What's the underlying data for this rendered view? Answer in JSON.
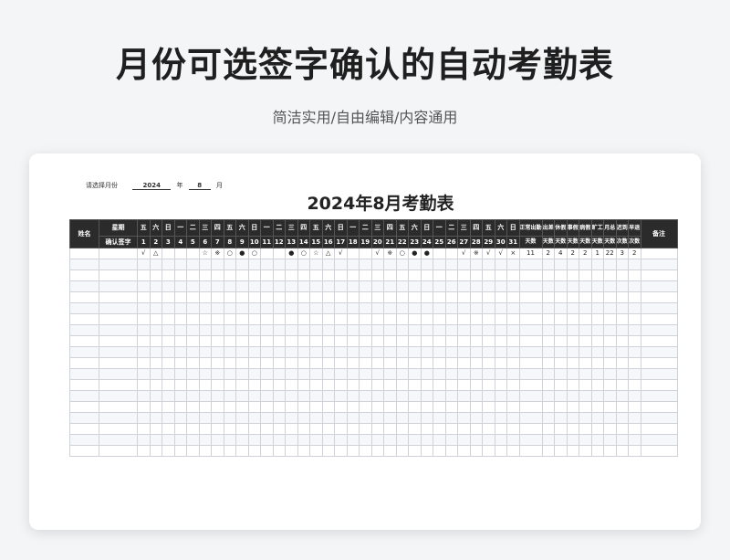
{
  "banner": {
    "title": "月份可选签字确认的自动考勤表",
    "subtitle": "简洁实用/自由编辑/内容通用"
  },
  "selector": {
    "label": "请选择月份",
    "year": "2024",
    "year_unit": "年",
    "month": "8",
    "month_unit": "月"
  },
  "sheet_title": "2024年8月考勤表",
  "header": {
    "name": "姓名",
    "weekday": "星期",
    "confirm": "确认签字",
    "weekdays": [
      "五",
      "六",
      "日",
      "一",
      "二",
      "三",
      "四",
      "五",
      "六",
      "日",
      "一",
      "二",
      "三",
      "四",
      "五",
      "六",
      "日",
      "一",
      "二",
      "三",
      "四",
      "五",
      "六",
      "日",
      "一",
      "二",
      "三",
      "四",
      "五",
      "六",
      "日"
    ],
    "days": [
      "1",
      "2",
      "3",
      "4",
      "5",
      "6",
      "7",
      "8",
      "9",
      "10",
      "11",
      "12",
      "13",
      "14",
      "15",
      "16",
      "17",
      "18",
      "19",
      "20",
      "21",
      "22",
      "23",
      "24",
      "25",
      "26",
      "27",
      "28",
      "29",
      "30",
      "31"
    ],
    "stats": [
      {
        "top": "正常出勤",
        "bottom": "天数"
      },
      {
        "top": "出差",
        "bottom": "天数"
      },
      {
        "top": "休假",
        "bottom": "天数"
      },
      {
        "top": "事假",
        "bottom": "天数"
      },
      {
        "top": "病假",
        "bottom": "天数"
      },
      {
        "top": "旷工",
        "bottom": "天数"
      },
      {
        "top": "月总",
        "bottom": "天数"
      },
      {
        "top": "迟到",
        "bottom": "次数"
      },
      {
        "top": "早退",
        "bottom": "次数"
      }
    ],
    "remark": "备注"
  },
  "rows": [
    {
      "marks": [
        "",
        "√",
        "△",
        "",
        "",
        "",
        "☆",
        "※",
        "○",
        "●",
        "○",
        "",
        "",
        "●",
        "○",
        "☆",
        "△",
        "√",
        "",
        "",
        "√",
        "※",
        "○",
        "●",
        "●",
        "",
        "",
        "√",
        "※",
        "√",
        "√",
        "×"
      ],
      "stats": [
        "11",
        "2",
        "4",
        "2",
        "2",
        "1",
        "22",
        "3",
        "2"
      ]
    }
  ],
  "empty_rows": 18
}
